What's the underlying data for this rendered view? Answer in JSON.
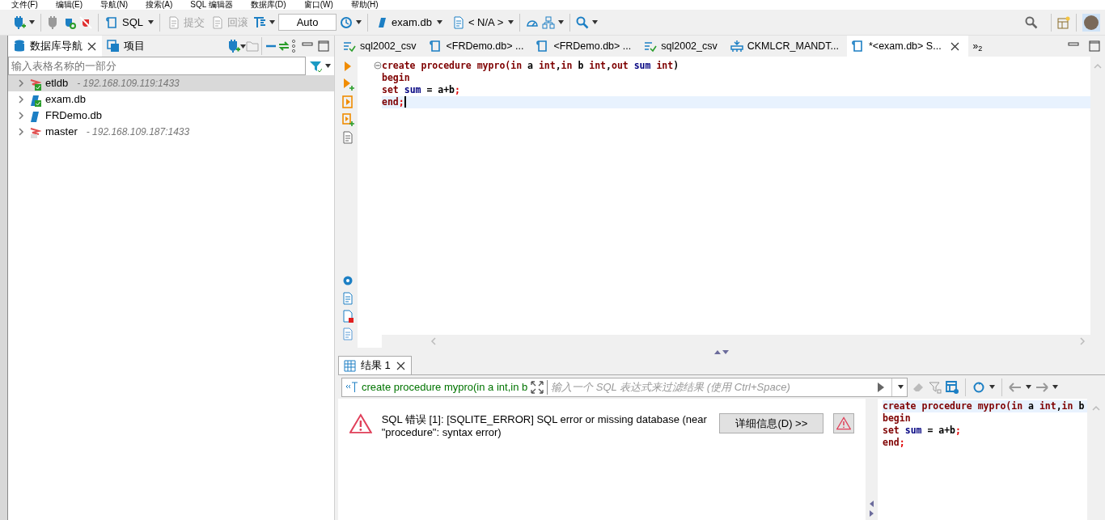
{
  "menu": [
    "文件(F)",
    "编辑(E)",
    "导航(N)",
    "搜索(A)",
    "SQL 编辑器",
    "数据库(D)",
    "窗口(W)",
    "帮助(H)"
  ],
  "toolbar": {
    "sql_label": "SQL",
    "actions": [
      {
        "label": "提交",
        "disabled": true
      },
      {
        "label": "回滚",
        "disabled": true
      }
    ],
    "mode": "Auto",
    "datasource": "exam.db",
    "schema": "< N/A >"
  },
  "navigator": {
    "tabs": [
      {
        "label": "数据库导航",
        "selected": true
      },
      {
        "label": "项目",
        "selected": false
      }
    ],
    "filter_placeholder": "输入表格名称的一部分",
    "tree": [
      {
        "label": "etldb",
        "detail": "- 192.168.109.119:1433",
        "kind": "server",
        "connected": true,
        "selected": true
      },
      {
        "label": "exam.db",
        "kind": "file",
        "connected": true,
        "selected": false
      },
      {
        "label": "FRDemo.db",
        "kind": "file",
        "connected": false,
        "selected": false
      },
      {
        "label": "master",
        "detail": "- 192.168.109.187:1433",
        "kind": "server",
        "connected": false,
        "selected": false
      }
    ]
  },
  "editor_tabs": [
    {
      "label": "sql2002_csv",
      "kind": "script",
      "selected": false
    },
    {
      "label": "<FRDemo.db> ...",
      "kind": "sql",
      "selected": false
    },
    {
      "label": "<FRDemo.db> ...",
      "kind": "sql",
      "selected": false
    },
    {
      "label": "sql2002_csv",
      "kind": "script",
      "selected": false
    },
    {
      "label": "CKMLCR_MANDT...",
      "kind": "table",
      "selected": false
    },
    {
      "label": "*<exam.db> S...",
      "kind": "sql",
      "selected": true
    }
  ],
  "tab_overflow": "»$_{2}$",
  "code": [
    [
      {
        "text": "create procedure mypro(",
        "kind": "keyword"
      },
      {
        "text": "in ",
        "kind": "keyword"
      },
      {
        "text": "a ",
        "kind": "plain"
      },
      {
        "text": "int",
        "kind": "keyword"
      },
      {
        "text": ",",
        "kind": "plain"
      },
      {
        "text": "in ",
        "kind": "keyword"
      },
      {
        "text": "b ",
        "kind": "plain"
      },
      {
        "text": "int",
        "kind": "keyword"
      },
      {
        "text": ",",
        "kind": "plain"
      },
      {
        "text": "out ",
        "kind": "keyword"
      },
      {
        "text": "sum ",
        "kind": "name"
      },
      {
        "text": "int",
        "kind": "keyword"
      },
      {
        "text": ")",
        "kind": "plain"
      }
    ],
    [
      {
        "text": "begin",
        "kind": "keyword"
      }
    ],
    [
      {
        "text": "set ",
        "kind": "keyword"
      },
      {
        "text": "sum",
        "kind": "name"
      },
      {
        "text": " = a+b",
        "kind": "plain"
      },
      {
        "text": ";",
        "kind": "punct"
      }
    ],
    [
      {
        "text": "end",
        "kind": "keyword"
      },
      {
        "text": ";",
        "kind": "punct"
      }
    ]
  ],
  "results": {
    "tab": {
      "label": "结果 1",
      "selected": true
    },
    "query": "create procedure mypro(in a int,in b",
    "filter_placeholder": "输入一个 SQL 表达式来过滤结果 (使用 Ctrl+Space)",
    "error": "SQL 错误 [1]: [SQLITE_ERROR] SQL error or missing database (near \"procedure\": syntax error)",
    "details_button": "详细信息(D) >>",
    "query_code": [
      [
        {
          "text": "create procedure mypro(",
          "kind": "keyword"
        },
        {
          "text": "in ",
          "kind": "keyword"
        },
        {
          "text": "a ",
          "kind": "plain"
        },
        {
          "text": "int",
          "kind": "keyword"
        },
        {
          "text": ",",
          "kind": "plain"
        },
        {
          "text": "in ",
          "kind": "keyword"
        },
        {
          "text": "b",
          "kind": "plain"
        }
      ],
      [
        {
          "text": "begin",
          "kind": "keyword"
        }
      ],
      [
        {
          "text": "set ",
          "kind": "keyword"
        },
        {
          "text": "sum",
          "kind": "name"
        },
        {
          "text": " = a+b",
          "kind": "plain"
        },
        {
          "text": ";",
          "kind": "punct"
        }
      ],
      [
        {
          "text": "end",
          "kind": "keyword"
        },
        {
          "text": ";",
          "kind": "punct"
        }
      ]
    ]
  }
}
